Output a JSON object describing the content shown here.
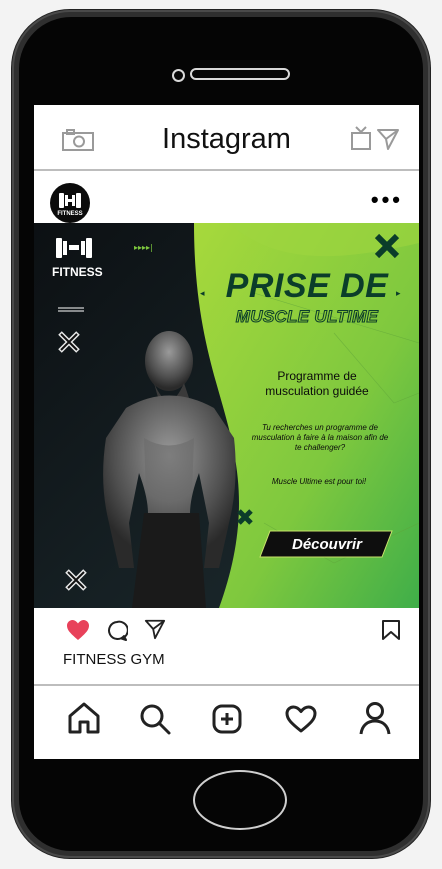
{
  "header": {
    "title": "Instagram"
  },
  "post": {
    "avatar_text": "FITNESS",
    "menu": "•••",
    "brand": "FITNESS",
    "headline": "PRISE DE",
    "subheadline": "MUSCLE ULTIME",
    "program": "Programme de musculation guidée",
    "question": "Tu recherches un programme de musculation à faire à la maison afin de te challenger?",
    "tagline": "Muscle Ultime est pour toi!",
    "cta": "Découvrir",
    "caption": "FITNESS GYM"
  },
  "colors": {
    "accent": "#8ccc3a",
    "dark_green": "#0b3d2a",
    "like": "#e8415a"
  }
}
